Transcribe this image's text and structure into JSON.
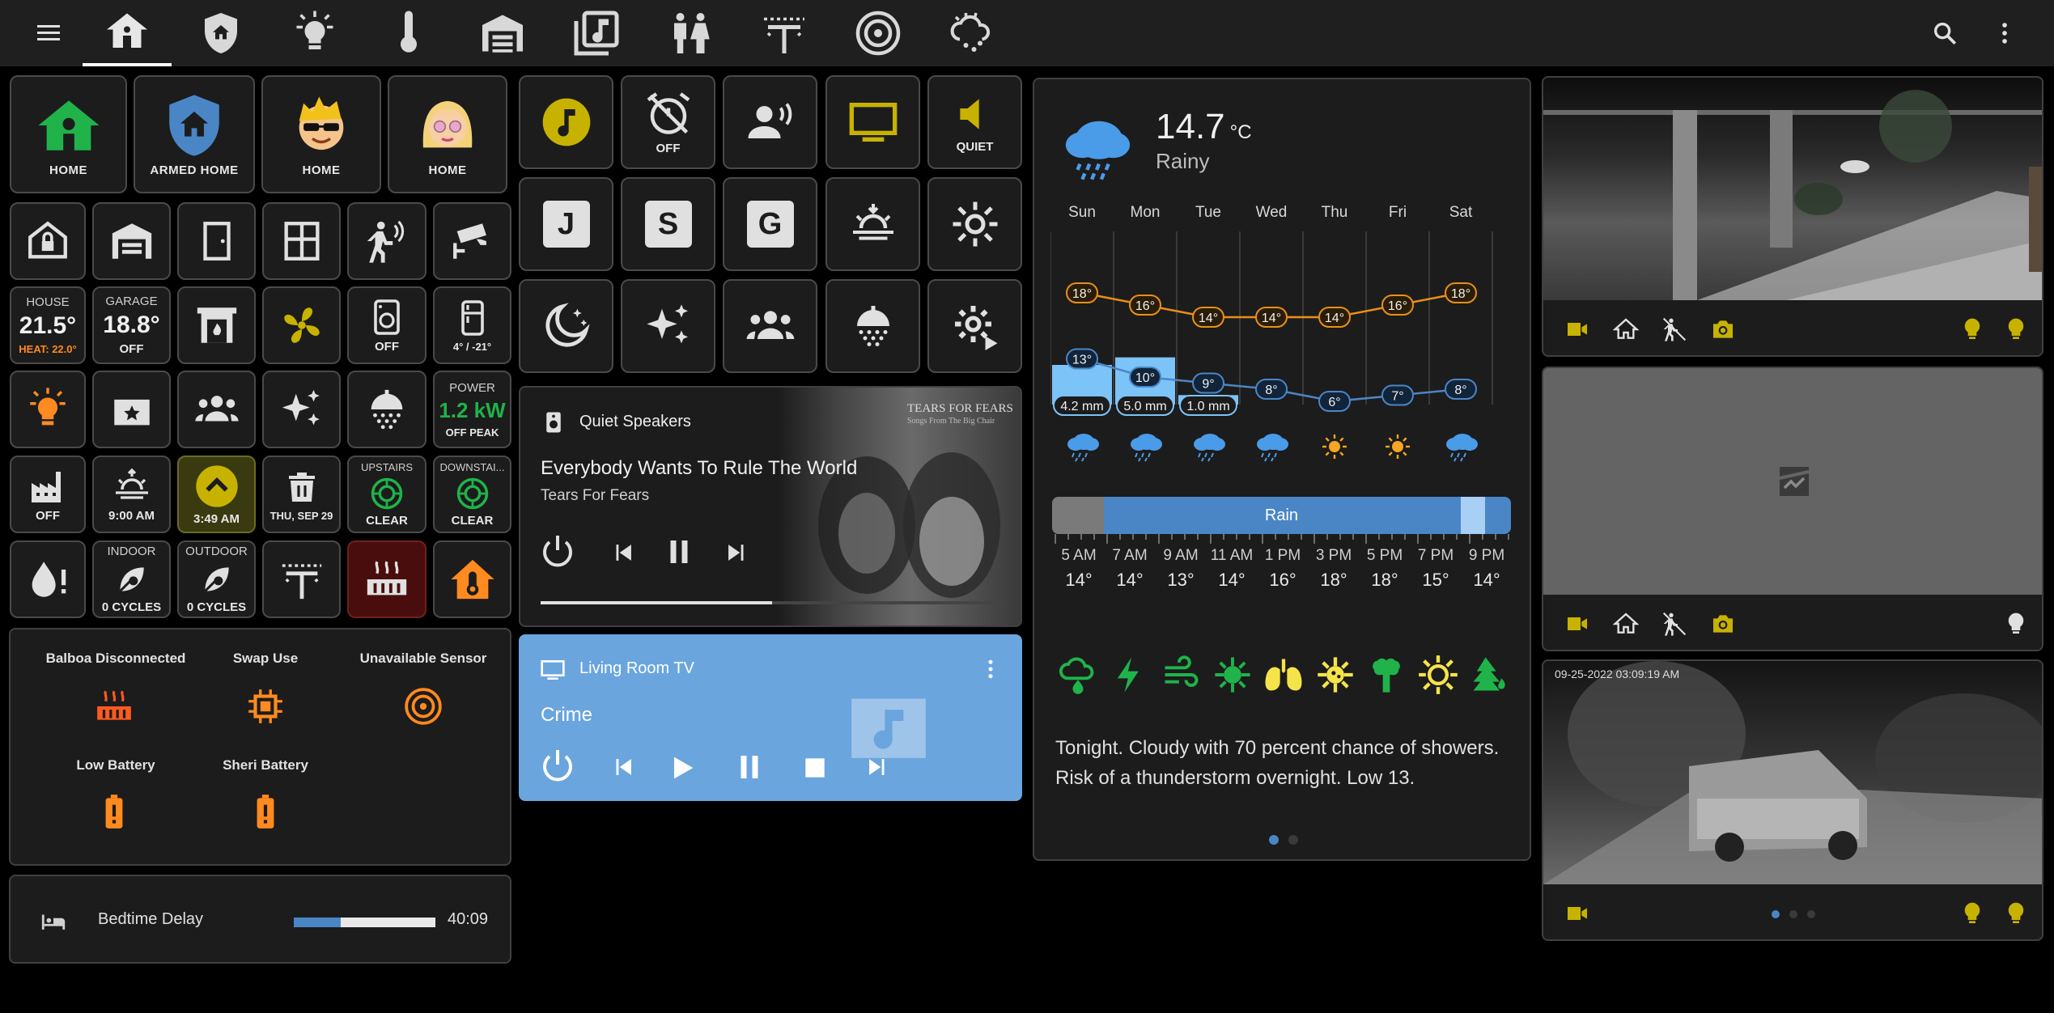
{
  "colors": {
    "accent_yellow": "#c8b200",
    "accent_orange": "#ff8a1f",
    "green": "#1fb34a",
    "blue": "#4a86c6",
    "tv_blue": "#6aa5de"
  },
  "nav": {
    "tabs": [
      "home-icon",
      "shield-home-icon",
      "lightbulb-icon",
      "thermometer-icon",
      "garage-icon",
      "music-library-icon",
      "human-male-female-icon",
      "wifi-antenna-icon",
      "speaker-icon",
      "weather-snowy-icon"
    ]
  },
  "people": [
    {
      "label": "HOME"
    },
    {
      "label": "ARMED HOME"
    },
    {
      "label": "HOME"
    },
    {
      "label": "HOME"
    }
  ],
  "climate": {
    "house": {
      "top": "HOUSE",
      "value": "21.5°",
      "sub": "HEAT: 22.0°"
    },
    "garage": {
      "top": "GARAGE",
      "value": "18.8°",
      "sub": "OFF"
    },
    "washer": {
      "sub": "OFF"
    },
    "fridge": {
      "sub": "4° / -21°"
    }
  },
  "power": {
    "top": "POWER",
    "value": "1.2 kW",
    "sub": "OFF PEAK"
  },
  "row5": {
    "fan_sub": "OFF",
    "sunrise_sub": "9:00 AM",
    "alarm_sub": "3:49 AM",
    "trash_sub": "THU, SEP 29",
    "upstairs": {
      "top": "UPSTAIRS",
      "sub": "CLEAR"
    },
    "downstairs": {
      "top": "DOWNSTAI...",
      "sub": "CLEAR"
    }
  },
  "row6": {
    "indoor": {
      "top": "INDOOR",
      "sub": "0 CYCLES"
    },
    "outdoor": {
      "top": "OUTDOOR",
      "sub": "0 CYCLES"
    }
  },
  "alerts": [
    {
      "label": "Balboa Disconnected"
    },
    {
      "label": "Swap Use"
    },
    {
      "label": "Unavailable Sensor"
    },
    {
      "label": "Low Battery"
    },
    {
      "label": "Sheri Battery"
    }
  ],
  "bedtime": {
    "label": "Bedtime Delay",
    "value": "40:09",
    "progress": 0.33
  },
  "media_tiles": {
    "alarm_off": "OFF",
    "quiet": "QUIET",
    "letters": [
      "J",
      "S",
      "G"
    ]
  },
  "speakers": {
    "name": "Quiet Speakers",
    "title": "Everybody Wants To Rule The World",
    "artist": "Tears For Fears",
    "album_text": "TEARS FOR FEARS",
    "album_sub": "Songs From The Big Chair",
    "progress": 0.5
  },
  "tv": {
    "name": "Living Room TV",
    "title": "Crime"
  },
  "weather": {
    "temp": "14.7",
    "unit": "°C",
    "condition": "Rainy",
    "days": [
      "Sun",
      "Mon",
      "Tue",
      "Wed",
      "Thu",
      "Fri",
      "Sat"
    ],
    "highs": [
      "18°",
      "16°",
      "14°",
      "14°",
      "14°",
      "16°",
      "18°"
    ],
    "high_vals": [
      18,
      16,
      14,
      14,
      14,
      16,
      18
    ],
    "lows": [
      "13°",
      "10°",
      "9°",
      "8°",
      "6°",
      "7°",
      "8°"
    ],
    "low_vals": [
      13,
      10,
      9,
      8,
      6,
      7,
      8
    ],
    "precip": [
      "4.2 mm",
      "5.0 mm",
      "1.0 mm"
    ],
    "precip_vals": [
      4.2,
      5.0,
      1.0
    ],
    "day_icons": [
      "rain",
      "rain",
      "rain",
      "rain",
      "sun",
      "sun",
      "rain"
    ],
    "timeline_label": "Rain",
    "hours": [
      "5 AM",
      "7 AM",
      "9 AM",
      "11 AM",
      "1 PM",
      "3 PM",
      "5 PM",
      "7 PM",
      "9 PM"
    ],
    "hour_temps": [
      "14°",
      "14°",
      "13°",
      "14°",
      "16°",
      "18°",
      "18°",
      "15°",
      "14°"
    ],
    "forecast_text": "Tonight. Cloudy with 70 percent chance of showers. Risk of a thunderstorm overnight. Low 13."
  },
  "cameras": {
    "cam3_timestamp": "09-25-2022 03:09:19 AM"
  }
}
